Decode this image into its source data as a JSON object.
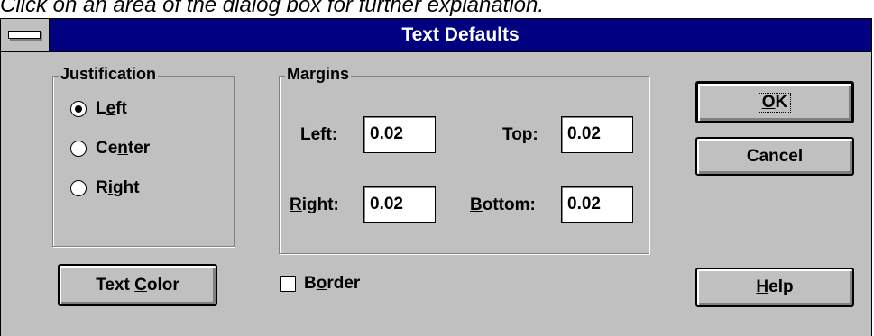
{
  "caption": "Click on an area of the dialog box for further explanation.",
  "dialog": {
    "title": "Text Defaults",
    "system_menu_icon": "system-menu-bar"
  },
  "justification": {
    "label": "Justification",
    "options": [
      {
        "pre": "L",
        "key": "e",
        "post": "ft",
        "selected": true
      },
      {
        "pre": "Ce",
        "key": "n",
        "post": "ter",
        "selected": false
      },
      {
        "pre": "R",
        "key": "i",
        "post": "ght",
        "selected": false
      }
    ]
  },
  "margins": {
    "label": "Margins",
    "left": {
      "pre": "",
      "key": "L",
      "post": "eft:",
      "value": "0.02"
    },
    "top": {
      "pre": "",
      "key": "T",
      "post": "op:",
      "value": "0.02"
    },
    "right": {
      "pre": "",
      "key": "R",
      "post": "ight:",
      "value": "0.02"
    },
    "bottom": {
      "pre": "",
      "key": "B",
      "post": "ottom:",
      "value": "0.02"
    }
  },
  "buttons": {
    "ok": {
      "pre": "",
      "key": "O",
      "post": "K"
    },
    "cancel": {
      "label": "Cancel"
    },
    "help": {
      "pre": "",
      "key": "H",
      "post": "elp"
    },
    "text_color": {
      "pre": "Text ",
      "key": "C",
      "post": "olor"
    }
  },
  "border_option": {
    "pre": "B",
    "key": "o",
    "post": "rder",
    "checked": false
  }
}
